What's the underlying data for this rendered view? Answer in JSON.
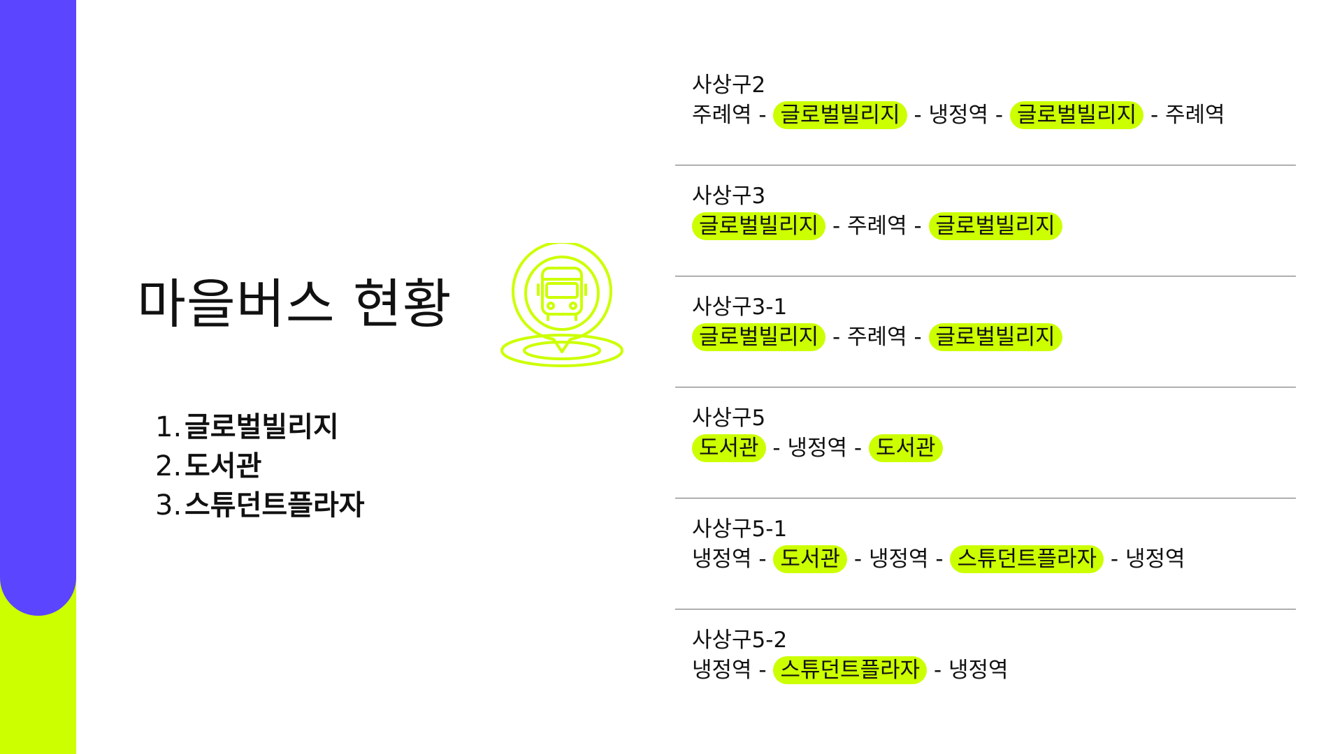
{
  "colors": {
    "purple": "#5c45ff",
    "lime": "#ccff00"
  },
  "title": "마을버스 현황",
  "icon": "bus-location-pin-icon",
  "stops_list": [
    {
      "num": "1.",
      "name": "글로벌빌리지"
    },
    {
      "num": "2.",
      "name": "도서관"
    },
    {
      "num": "3.",
      "name": "스튜던트플라자"
    }
  ],
  "separator": " - ",
  "routes": [
    {
      "name": "사상구2",
      "stops": [
        {
          "text": "주례역",
          "highlight": false
        },
        {
          "text": "글로벌빌리지",
          "highlight": true
        },
        {
          "text": "냉정역",
          "highlight": false
        },
        {
          "text": "글로벌빌리지",
          "highlight": true
        },
        {
          "text": "주례역",
          "highlight": false
        }
      ]
    },
    {
      "name": "사상구3",
      "stops": [
        {
          "text": "글로벌빌리지",
          "highlight": true
        },
        {
          "text": "주례역",
          "highlight": false
        },
        {
          "text": "글로벌빌리지",
          "highlight": true
        }
      ]
    },
    {
      "name": "사상구3-1",
      "stops": [
        {
          "text": "글로벌빌리지",
          "highlight": true
        },
        {
          "text": "주례역",
          "highlight": false
        },
        {
          "text": "글로벌빌리지",
          "highlight": true
        }
      ]
    },
    {
      "name": "사상구5",
      "stops": [
        {
          "text": "도서관",
          "highlight": true
        },
        {
          "text": "냉정역",
          "highlight": false
        },
        {
          "text": "도서관",
          "highlight": true
        }
      ]
    },
    {
      "name": "사상구5-1",
      "stops": [
        {
          "text": "냉정역",
          "highlight": false
        },
        {
          "text": "도서관",
          "highlight": true
        },
        {
          "text": "냉정역",
          "highlight": false
        },
        {
          "text": "스튜던트플라자",
          "highlight": true
        },
        {
          "text": "냉정역",
          "highlight": false
        }
      ]
    },
    {
      "name": "사상구5-2",
      "stops": [
        {
          "text": "냉정역",
          "highlight": false
        },
        {
          "text": "스튜던트플라자",
          "highlight": true
        },
        {
          "text": "냉정역",
          "highlight": false
        }
      ]
    }
  ]
}
